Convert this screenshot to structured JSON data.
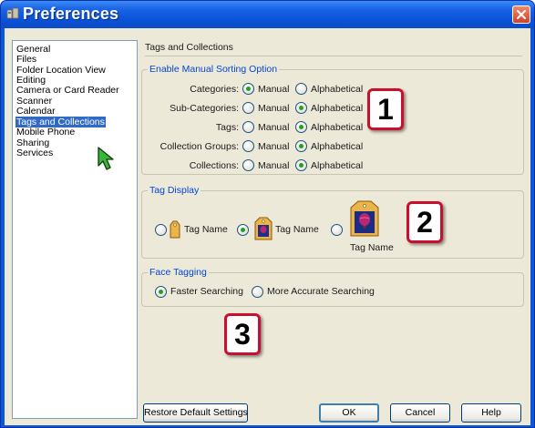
{
  "window": {
    "title": "Preferences"
  },
  "sidebar": {
    "items": [
      {
        "label": "General"
      },
      {
        "label": "Files"
      },
      {
        "label": "Folder Location View"
      },
      {
        "label": "Editing"
      },
      {
        "label": "Camera or Card Reader"
      },
      {
        "label": "Scanner"
      },
      {
        "label": "Calendar"
      },
      {
        "label": "Tags and Collections",
        "selected": true
      },
      {
        "label": "Mobile Phone"
      },
      {
        "label": "Sharing"
      },
      {
        "label": "Services"
      }
    ]
  },
  "panel": {
    "heading": "Tags and Collections",
    "sorting": {
      "title": "Enable Manual Sorting Option",
      "option_manual": "Manual",
      "option_alpha": "Alphabetical",
      "rows": [
        {
          "label": "Categories:",
          "selected": "Manual"
        },
        {
          "label": "Sub-Categories:",
          "selected": "Alphabetical"
        },
        {
          "label": "Tags:",
          "selected": "Alphabetical"
        },
        {
          "label": "Collection Groups:",
          "selected": "Alphabetical"
        },
        {
          "label": "Collections:",
          "selected": "Alphabetical"
        }
      ]
    },
    "tag_display": {
      "title": "Tag Display",
      "options": [
        {
          "label": "Tag Name",
          "icon": "small-tag-icon",
          "selected": false
        },
        {
          "label": "Tag Name",
          "icon": "medium-photo-tag-icon",
          "selected": true
        },
        {
          "label": "Tag Name",
          "icon": "large-photo-tag-icon",
          "selected": false
        }
      ]
    },
    "face_tagging": {
      "title": "Face Tagging",
      "options": [
        {
          "label": "Faster Searching",
          "selected": true
        },
        {
          "label": "More Accurate Searching",
          "selected": false
        }
      ]
    }
  },
  "callouts": [
    "1",
    "2",
    "3"
  ],
  "buttons": {
    "restore": "Restore Default Settings",
    "ok": "OK",
    "cancel": "Cancel",
    "help": "Help"
  },
  "colors": {
    "titlebar": "#0a57d8",
    "dialog_bg": "#ece9d8",
    "selection": "#316ac5",
    "group_title": "#0046d5",
    "radio_dot": "#21a121",
    "callout_border": "#c8102e"
  }
}
